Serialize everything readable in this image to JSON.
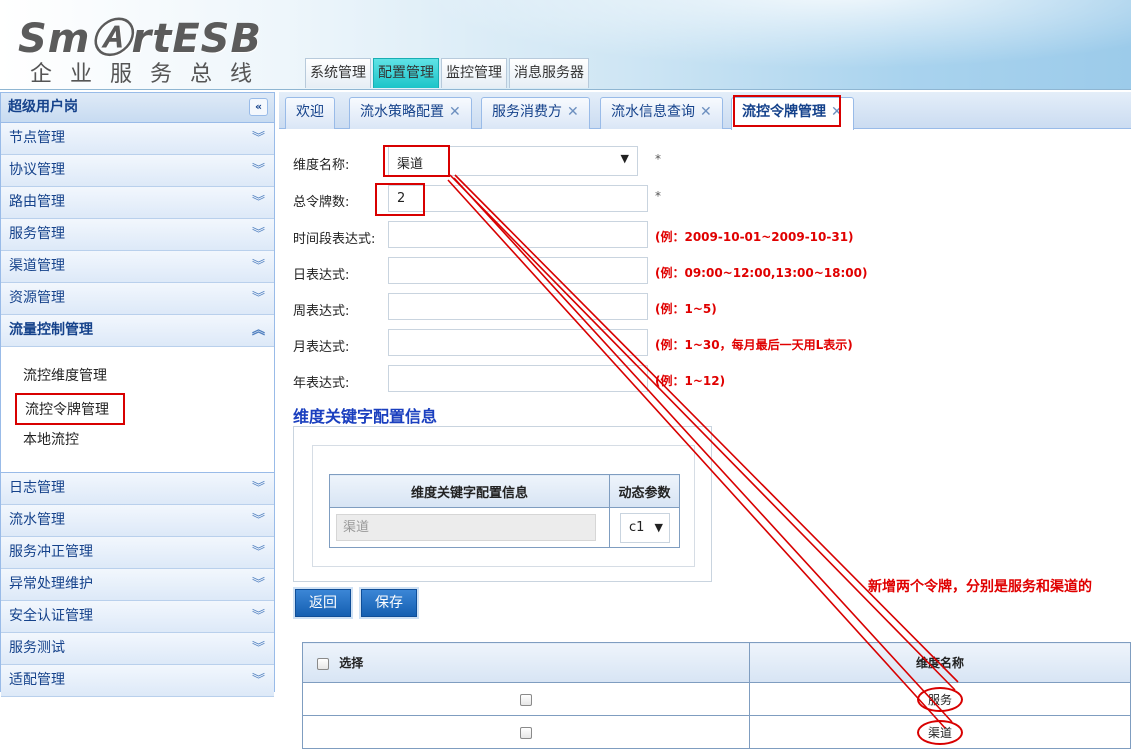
{
  "header": {
    "logo": "SmⒶrtESB",
    "slogan": "企业服务总线",
    "nav": [
      "系统管理",
      "配置管理",
      "监控管理",
      "消息服务器"
    ],
    "active_nav_index": 1
  },
  "sidebar": {
    "title": "超级用户岗",
    "collapse_icon": "«",
    "items_before": [
      "节点管理",
      "协议管理",
      "路由管理",
      "服务管理",
      "渠道管理",
      "资源管理"
    ],
    "open_item": "流量控制管理",
    "sub_items": [
      "流控维度管理",
      "流控令牌管理",
      "本地流控"
    ],
    "highlighted_sub": "流控令牌管理",
    "items_after": [
      "日志管理",
      "流水管理",
      "服务冲正管理",
      "异常处理维护",
      "安全认证管理",
      "服务测试",
      "适配管理"
    ]
  },
  "tabs": [
    {
      "label": "欢迎",
      "closable": false
    },
    {
      "label": "流水策略配置",
      "closable": true
    },
    {
      "label": "服务消费方",
      "closable": true
    },
    {
      "label": "流水信息查询",
      "closable": true
    },
    {
      "label": "流控令牌管理",
      "closable": true,
      "active": true
    }
  ],
  "form": {
    "dimension_label": "维度名称:",
    "dimension_value": "渠道",
    "total_tokens_label": "总令牌数:",
    "total_tokens_value": "2",
    "required_mark": "*",
    "time_range_label": "时间段表达式:",
    "time_range_hint": "(例：2009-10-01~2009-10-31)",
    "daily_label": "日表达式:",
    "daily_hint": "(例：09:00~12:00,13:00~18:00)",
    "weekly_label": "周表达式:",
    "weekly_hint": "(例：1~5)",
    "monthly_label": "月表达式:",
    "monthly_hint": "(例：1~30，每月最后一天用L表示)",
    "yearly_label": "年表达式:",
    "yearly_hint": "(例：1~12)"
  },
  "keyword_section": {
    "title": "维度关键字配置信息",
    "headers": [
      "维度关键字配置信息",
      "动态参数"
    ],
    "row": {
      "keyword": "渠道",
      "param": "c1"
    }
  },
  "buttons": {
    "back": "返回",
    "save": "保存"
  },
  "annotation": "新增两个令牌，分别是服务和渠道的",
  "result_table": {
    "headers": [
      "选择",
      "维度名称"
    ],
    "rows": [
      "服务",
      "渠道"
    ]
  },
  "colors": {
    "highlight": "#d80000",
    "accent": "#15428b",
    "active_nav": "#1cc4c9"
  }
}
